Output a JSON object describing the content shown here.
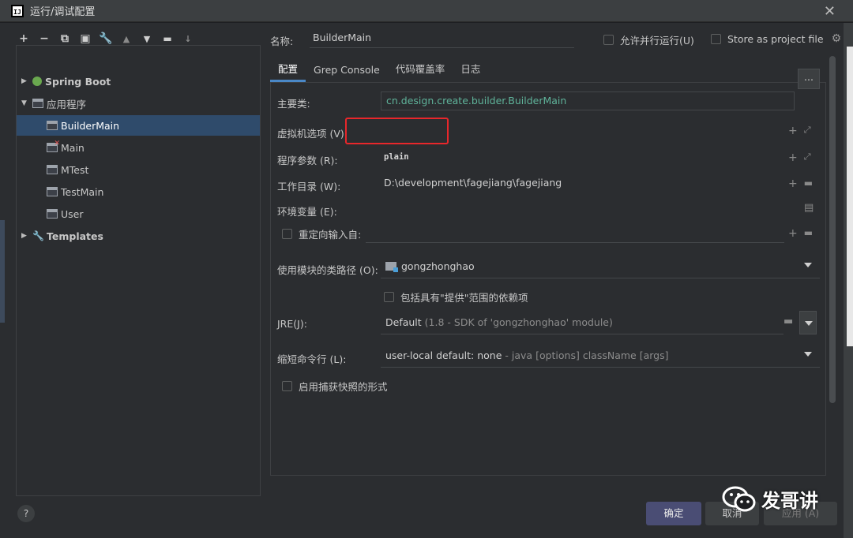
{
  "window": {
    "title": "运行/调试配置",
    "close_icon": "close-icon"
  },
  "toolbar": {
    "icons": [
      "add-icon",
      "remove-icon",
      "copy-icon",
      "save-icon",
      "wrench-icon",
      "move-up-icon",
      "move-down-icon",
      "folder-add-icon",
      "sort-icon"
    ]
  },
  "tree": {
    "items": [
      {
        "label": "Spring Boot",
        "level": 0,
        "expanded": false,
        "icon": "spring-boot-icon"
      },
      {
        "label": "应用程序",
        "level": 0,
        "expanded": true,
        "icon": "application-icon"
      },
      {
        "label": "BuilderMain",
        "level": 1,
        "selected": true,
        "icon": "application-icon"
      },
      {
        "label": "Main",
        "level": 1,
        "icon": "application-error-icon"
      },
      {
        "label": "MTest",
        "level": 1,
        "icon": "application-icon"
      },
      {
        "label": "TestMain",
        "level": 1,
        "icon": "application-icon"
      },
      {
        "label": "User",
        "level": 1,
        "icon": "application-icon"
      },
      {
        "label": "Templates",
        "level": 0,
        "expanded": false,
        "icon": "wrench-icon"
      }
    ]
  },
  "header": {
    "name_label": "名称:",
    "name_value": "BuilderMain",
    "allow_parallel": "允许并行运行(U)",
    "store_as_project": "Store as project file"
  },
  "tabs": [
    {
      "label": "配置",
      "active": true
    },
    {
      "label": "Grep Console"
    },
    {
      "label": "代码覆盖率"
    },
    {
      "label": "日志"
    }
  ],
  "form": {
    "main_class_label": "主要类:",
    "main_class_value": "cn.design.create.builder.BuilderMain",
    "main_class_button": "...",
    "vm_options_label": "虚拟机选项 (V):",
    "vm_options_value": "",
    "program_args_label": "程序参数 (R):",
    "program_args_value": "plain",
    "working_dir_label": "工作目录 (W):",
    "working_dir_value": "D:\\development\\fagejiang\\fagejiang",
    "env_label": "环境变量 (E):",
    "redirect_label": "重定向输入自:",
    "module_label": "使用模块的类路径 (O):",
    "module_value": "gongzhonghao",
    "include_provided_label": "包括具有\"提供\"范围的依赖项",
    "jre_label": "JRE(J):",
    "jre_value": "Default",
    "jre_detail": "(1.8 - SDK of 'gongzhonghao' module)",
    "shorten_label": "缩短命令行 (L):",
    "shorten_value": "user-local default: none",
    "shorten_detail": "- java [options] className [args]",
    "snapshot_label": "启用捕获快照的形式"
  },
  "buttons": {
    "help": "?",
    "ok": "确定",
    "cancel": "取消",
    "apply": "应用 (A)"
  },
  "watermark": {
    "text": "发哥讲"
  },
  "colors": {
    "accent": "#4a88c7",
    "selection": "#2f4b6b",
    "highlight_box": "#e8272b",
    "main_class_text": "#5fb39a"
  }
}
